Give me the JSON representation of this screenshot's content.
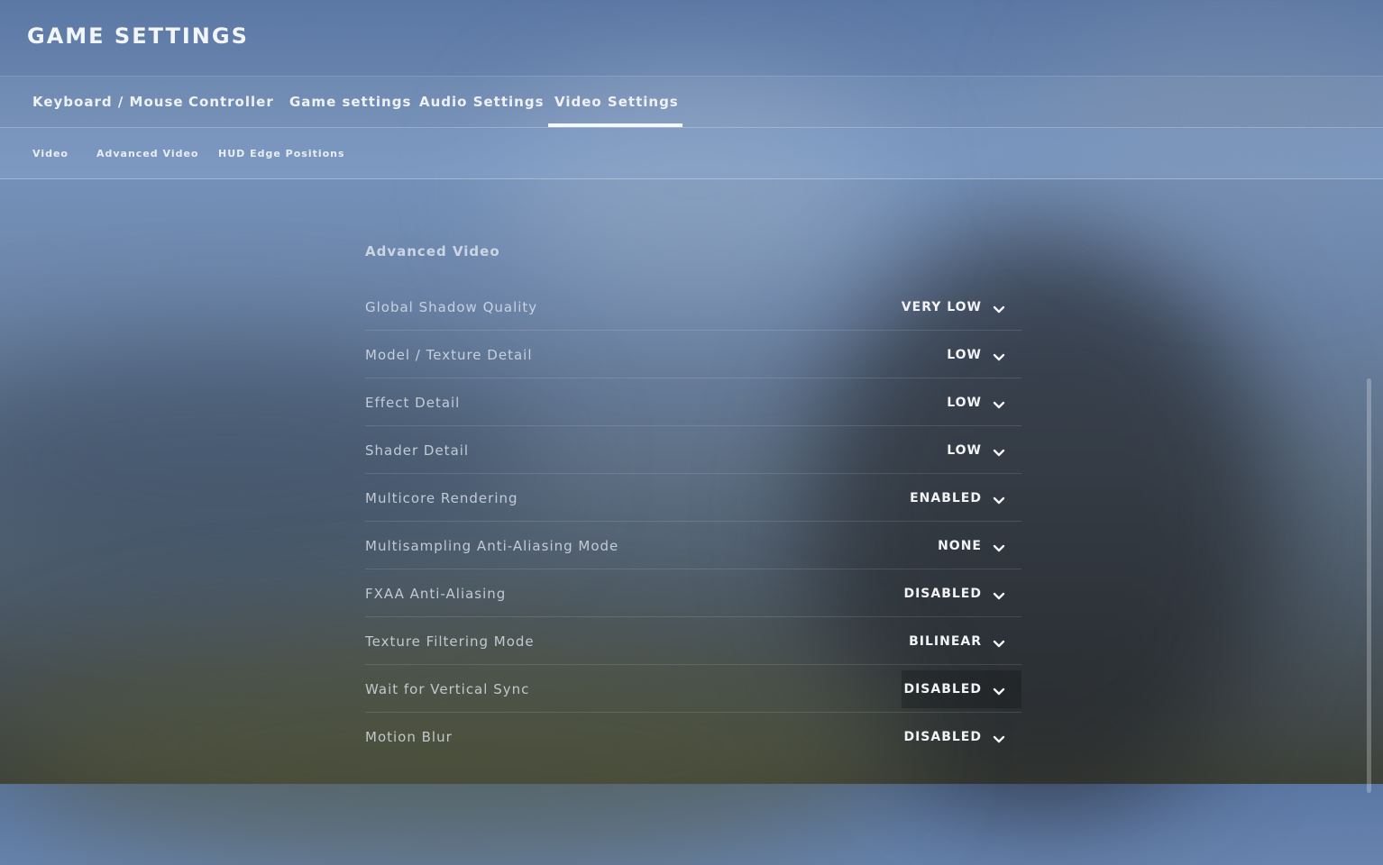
{
  "header": {
    "title": "GAME SETTINGS"
  },
  "tabs": [
    {
      "label": "Keyboard / Mouse"
    },
    {
      "label": "Controller"
    },
    {
      "label": "Game settings"
    },
    {
      "label": "Audio Settings"
    },
    {
      "label": "Video Settings",
      "active": true
    }
  ],
  "subtabs": [
    {
      "label": "Video"
    },
    {
      "label": "Advanced Video"
    },
    {
      "label": "HUD Edge Positions"
    }
  ],
  "section": {
    "title": "Advanced Video"
  },
  "settings": [
    {
      "label": "Global Shadow Quality",
      "value": "VERY LOW"
    },
    {
      "label": "Model / Texture Detail",
      "value": "LOW"
    },
    {
      "label": "Effect Detail",
      "value": "LOW"
    },
    {
      "label": "Shader Detail",
      "value": "LOW"
    },
    {
      "label": "Multicore Rendering",
      "value": "ENABLED"
    },
    {
      "label": "Multisampling Anti-Aliasing Mode",
      "value": "NONE"
    },
    {
      "label": "FXAA Anti-Aliasing",
      "value": "DISABLED"
    },
    {
      "label": "Texture Filtering Mode",
      "value": "BILINEAR"
    },
    {
      "label": "Wait for Vertical Sync",
      "value": "DISABLED",
      "hovered": true
    },
    {
      "label": "Motion Blur",
      "value": "DISABLED"
    }
  ],
  "icons": {
    "dropdown": "chevron-down-icon"
  },
  "colors": {
    "accent": "#f4f7fb"
  }
}
